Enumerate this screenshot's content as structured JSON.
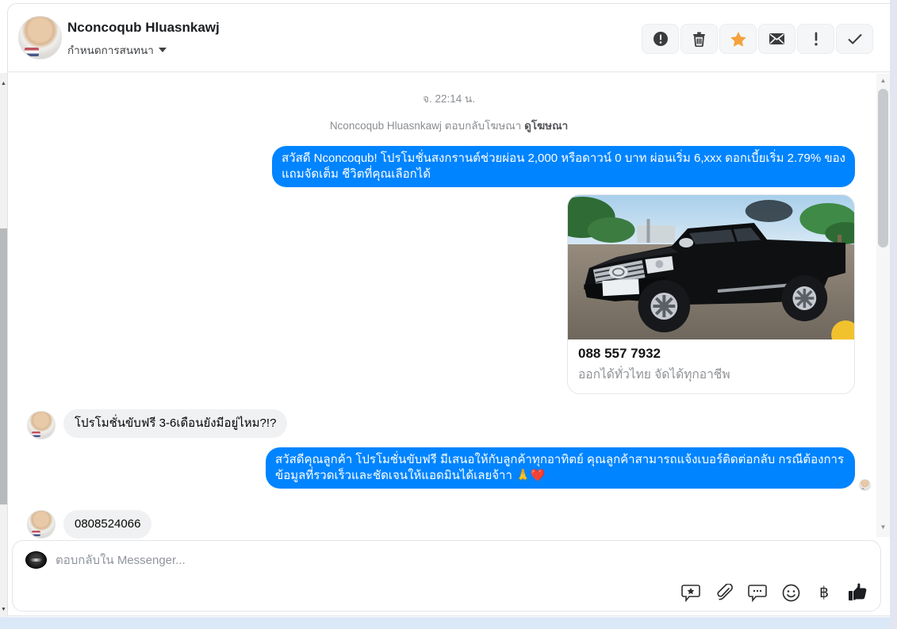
{
  "header": {
    "name": "Nconcoqub Hluasnkawj",
    "subtitle": "กำหนดการสนทนา",
    "actions": [
      "alert-circle",
      "trash",
      "star-followup",
      "mark-unread-envelope",
      "exclamation",
      "mark-done-check"
    ]
  },
  "conversation": {
    "timestamp": "จ. 22:14 น.",
    "context_name": "Nconcoqub Hluasnkawj",
    "context_action": " ตอบกลับโฆษณา ",
    "context_link": "ดูโฆษณา",
    "messages": {
      "outgoing_1": "สวัสดี Nconcoqub! โปรโมชั่นสงกรานต์ช่วยผ่อน 2,000 หรือดาวน์ 0 บาท ผ่อนเริ่ม 6,xxx ดอกเบี้ยเริ่ม 2.79% ของแถมจัดเต็ม ชีวิตที่คุณเลือกได้",
      "incoming_1": "โปรโมชั่นขับฟรี 3-6เดือนยังมีอยู่ไหม?!?",
      "outgoing_2": "สวัสดีคุณลูกค้า โปรโมชั่นขับฟรี มีเสนอให้กับลูกค้าทุกอาทิตย์ คุณลูกค้าสามารถแจ้งเบอร์ติดต่อกลับ กรณีต้องการข้อมูลที่รวดเร็วและชัดเจนให้แอดมินได้เลยจ้าา 🙏❤️",
      "incoming_2": "0808524066"
    },
    "ad_card": {
      "phone": "088 557 7932",
      "caption": "ออกได้ทั่วไทย จัดได้ทุกอาชีพ",
      "image_alt": "black Toyota Hilux pickup truck"
    }
  },
  "composer": {
    "placeholder": "ตอบกลับใน Messenger...",
    "baht_symbol": "฿",
    "icons": [
      "saved-reply-bubble-star",
      "attachment-paperclip",
      "comment-bubble-dots",
      "emoji-smiley",
      "payment-baht",
      "like-thumb"
    ]
  },
  "colors": {
    "bubble_blue": "#0084ff",
    "incoming_gray": "#f0f1f2",
    "star_orange": "#f5a13d",
    "bottom_strip_blue": "#dbe8f8",
    "right_edge_lavender": "#e3e5f1"
  }
}
